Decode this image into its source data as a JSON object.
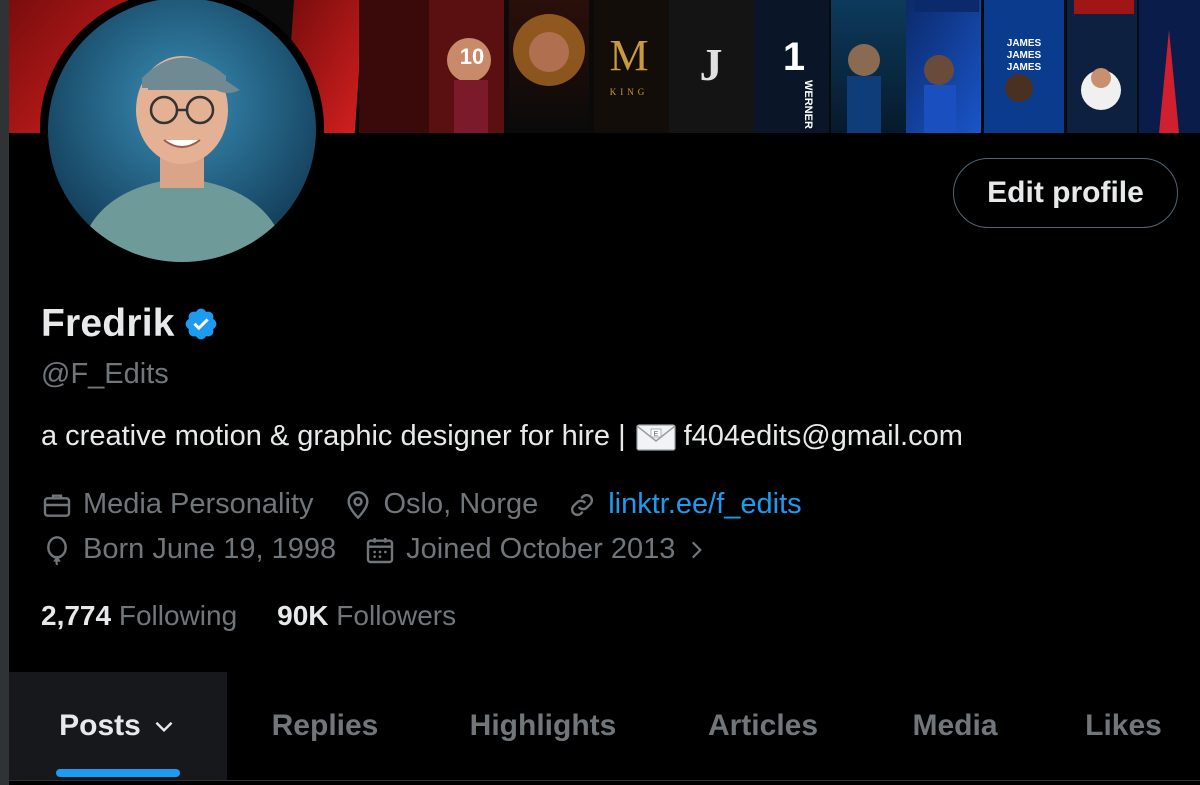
{
  "profile": {
    "name": "Fredrik",
    "handle": "@F_Edits",
    "bio_text": "a creative motion & graphic designer for hire |",
    "bio_email": "f404edits@gmail.com",
    "edit_button_label": "Edit profile",
    "verified_color": "#1d9bf0"
  },
  "meta": {
    "category": "Media Personality",
    "location": "Oslo, Norge",
    "website": "linktr.ee/f_edits",
    "birthday": "Born June 19, 1998",
    "joined": "Joined October 2013"
  },
  "stats": {
    "following_count": "2,774",
    "following_label": "Following",
    "followers_count": "90K",
    "followers_label": "Followers"
  },
  "tabs": [
    {
      "label": "Posts",
      "active": true
    },
    {
      "label": "Replies",
      "active": false
    },
    {
      "label": "Highlights",
      "active": false
    },
    {
      "label": "Articles",
      "active": false
    },
    {
      "label": "Media",
      "active": false
    },
    {
      "label": "Likes",
      "active": false
    }
  ],
  "banner": {
    "jersey_number": "10",
    "king_text": "KING",
    "werner_text": "WERNER",
    "james_lines": [
      "JAMES",
      "JAMES",
      "JAMES"
    ]
  },
  "colors": {
    "accent": "#1d9bf0",
    "background": "#000000",
    "muted_text": "#71767b",
    "primary_text": "#e7e9ea"
  }
}
